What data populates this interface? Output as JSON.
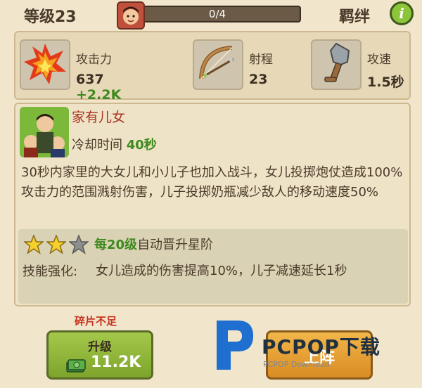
{
  "header": {
    "level_label": "等级23",
    "progress_text": "0/4",
    "progress_fraction": 0,
    "bond_label": "羁绊",
    "info_icon": "info-icon"
  },
  "stats": [
    {
      "icon": "fire-explosion-icon",
      "label": "攻击力",
      "value": "637",
      "bonus": "+2.2K"
    },
    {
      "icon": "bow-icon",
      "label": "射程",
      "value": "23",
      "bonus": ""
    },
    {
      "icon": "shovel-icon",
      "label": "攻速",
      "value": "1.5秒",
      "bonus": ""
    }
  ],
  "skill": {
    "name": "家有儿女",
    "cooldown_label": "冷却时间",
    "cooldown_value": "40秒",
    "description": "30秒内家里的大女儿和小儿子也加入战斗，女儿投掷炮仗造成100%攻击力的范围溅射伤害，儿子投掷奶瓶减少敌人的移动速度50%",
    "stars_filled": 2,
    "stars_total": 3,
    "star_rule_highlight": "每20级",
    "star_rule_rest": "自动晋升星阶",
    "enhance_label": "技能强化:",
    "enhance_text": "女儿造成的伤害提高10%，儿子减速延长1秒"
  },
  "bottom": {
    "insufficient_text": "碎片不足",
    "upgrade_label": "升级",
    "upgrade_cost": "11.2K",
    "deploy_label": "上阵"
  },
  "watermark": {
    "text": "PCPOP下载",
    "sub": "PCPOP Download"
  },
  "colors": {
    "background": "#f1e6cc",
    "accent_green": "#3e8a1e",
    "skill_name_red": "#a8351f",
    "warning_red": "#c7321e",
    "upgrade_button": "#8cb43a",
    "deploy_button": "#e9a23a"
  }
}
